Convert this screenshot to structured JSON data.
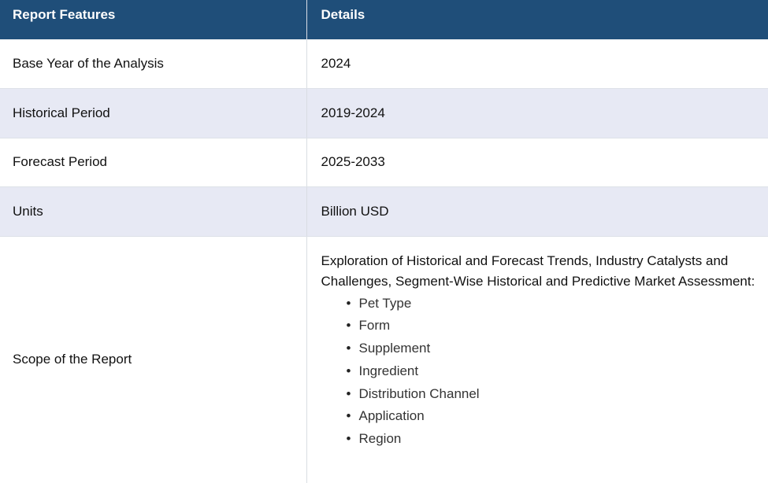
{
  "table": {
    "headers": [
      "Report Features",
      "Details"
    ],
    "rows": [
      {
        "feature": "Base Year of the Analysis",
        "detail": "2024"
      },
      {
        "feature": "Historical Period",
        "detail": "2019-2024"
      },
      {
        "feature": "Forecast Period",
        "detail": "2025-2033"
      },
      {
        "feature": "Units",
        "detail": "Billion USD"
      }
    ],
    "scope": {
      "feature": "Scope of the Report",
      "intro": "Exploration of Historical and Forecast Trends, Industry Catalysts and Challenges, Segment-Wise Historical and Predictive Market Assessment:",
      "items": [
        "Pet Type",
        "Form",
        "Supplement",
        "Ingredient",
        "Distribution Channel",
        "Application",
        "Region"
      ]
    }
  },
  "colors": {
    "header_bg": "#1f4e79",
    "header_text": "#ffffff",
    "alt_row_bg": "#e7e9f4"
  },
  "icons": {
    "list_bullet": "bullet-dot"
  }
}
